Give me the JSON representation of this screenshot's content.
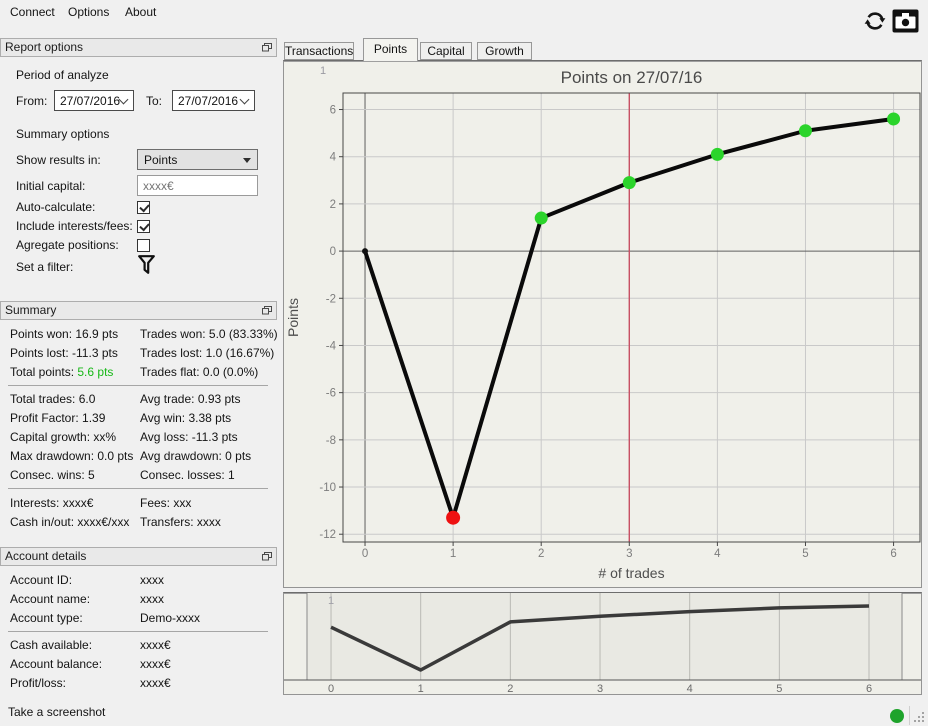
{
  "menu": {
    "items": [
      "Connect",
      "Options",
      "About"
    ]
  },
  "toolbar": {
    "icons": [
      "refresh-icon",
      "camera-icon"
    ]
  },
  "tabs": {
    "items": [
      "Transactions",
      "Points",
      "Capital",
      "Growth"
    ],
    "active": "Points"
  },
  "report_options": {
    "title": "Report options",
    "period_label": "Period of analyze",
    "from_label": "From:",
    "from_value": "27/07/2016",
    "to_label": "To:",
    "to_value": "27/07/2016",
    "summary_options_label": "Summary options",
    "show_results_label": "Show results in:",
    "show_results_value": "Points",
    "initial_capital_label": "Initial capital:",
    "initial_capital_placeholder": "xxxx€",
    "checkboxes": [
      {
        "label": "Auto-calculate:",
        "checked": true
      },
      {
        "label": "Include interests/fees:",
        "checked": true
      },
      {
        "label": "Agregate positions:",
        "checked": false
      }
    ],
    "filter_label": "Set a filter:",
    "filter_icon": "filter-funnel-icon"
  },
  "summary": {
    "title": "Summary",
    "groups": [
      {
        "rows": [
          {
            "left": "Points won: 16.9 pts",
            "right": "Trades won: 5.0 (83.33%)"
          },
          {
            "left": "Points lost: -11.3 pts",
            "right": "Trades lost: 1.0 (16.67%)"
          },
          {
            "left": "Total points: ",
            "left_accent": "5.6 pts",
            "right": "Trades flat: 0.0 (0.0%)"
          }
        ]
      },
      {
        "rows": [
          {
            "left": "Total trades: 6.0",
            "right": "Avg trade: 0.93 pts"
          },
          {
            "left": "Profit Factor: 1.39",
            "right": "Avg win: 3.38 pts"
          },
          {
            "left": "Capital growth: xx%",
            "right": "Avg loss: -11.3 pts"
          },
          {
            "left": "Max drawdown: 0.0 pts",
            "right": "Avg drawdown: 0 pts"
          },
          {
            "left": "Consec. wins: 5",
            "right": "Consec. losses: 1"
          }
        ]
      },
      {
        "rows": [
          {
            "left": "Interests: xxxx€",
            "right": "Fees: xxx"
          },
          {
            "left": "Cash in/out: xxxx€/xxx",
            "right": "Transfers: xxxx"
          }
        ]
      }
    ]
  },
  "account": {
    "title": "Account details",
    "groups": [
      {
        "rows": [
          {
            "left": "Account ID:",
            "right": "xxxx"
          },
          {
            "left": "Account name:",
            "right": "xxxx"
          },
          {
            "left": "Account type:",
            "right": "Demo-xxxx"
          }
        ]
      },
      {
        "rows": [
          {
            "left": "Cash available:",
            "right": "xxxx€"
          },
          {
            "left": "Account balance:",
            "right": "xxxx€"
          },
          {
            "left": "Profit/loss:",
            "right": "xxxx€"
          }
        ]
      }
    ]
  },
  "statusbar": {
    "message": "Take a screenshot",
    "status_icon": "connection-status-icon"
  },
  "colors": {
    "positive_green": "#17b817",
    "marker_green": "#2bd42b",
    "marker_red": "#ee1111",
    "vline_crimson": "#c84f63",
    "status_green": "#1ea32b",
    "main_line": "#0a0a0a",
    "overview_line": "#3a3a3a"
  },
  "chart_data": [
    {
      "type": "line",
      "title": "Points on 27/07/16",
      "xlabel": "# of trades",
      "ylabel": "Points",
      "x": [
        0,
        1,
        2,
        3,
        4,
        5,
        6
      ],
      "y": [
        0,
        -11.3,
        1.4,
        2.9,
        4.1,
        5.1,
        5.6
      ],
      "xticks": [
        0,
        1,
        2,
        3,
        4,
        5,
        6
      ],
      "yticks": [
        6,
        4,
        2,
        0,
        -2,
        -4,
        -6,
        -8,
        -10,
        -12
      ],
      "xlim": [
        -0.25,
        6.3
      ],
      "ylim": [
        -12.33,
        6.7
      ],
      "grid": true,
      "legend": "none",
      "marker_colors": [
        "#111111",
        "#ee1111",
        "#2bd42b",
        "#2bd42b",
        "#2bd42b",
        "#2bd42b",
        "#2bd42b"
      ],
      "marker_sizes": [
        3,
        7,
        6.5,
        6.5,
        6.5,
        6.5,
        6.5
      ],
      "vline_x": 3,
      "clipped_axis_labels": [
        "0",
        "1"
      ]
    },
    {
      "type": "line",
      "title": "",
      "xlabel": "",
      "ylabel": "",
      "x": [
        0,
        1,
        2,
        3,
        4,
        5,
        6
      ],
      "y": [
        0,
        -11.3,
        1.4,
        2.9,
        4.1,
        5.1,
        5.6
      ],
      "xticks": [
        0,
        1,
        2,
        3,
        4,
        5,
        6
      ],
      "xlim": [
        -0.268,
        6.368
      ],
      "ylim": [
        -13.94,
        9.03
      ],
      "grid": true,
      "legend": "none",
      "clipped_axis_labels": [
        "0",
        "1"
      ]
    }
  ]
}
